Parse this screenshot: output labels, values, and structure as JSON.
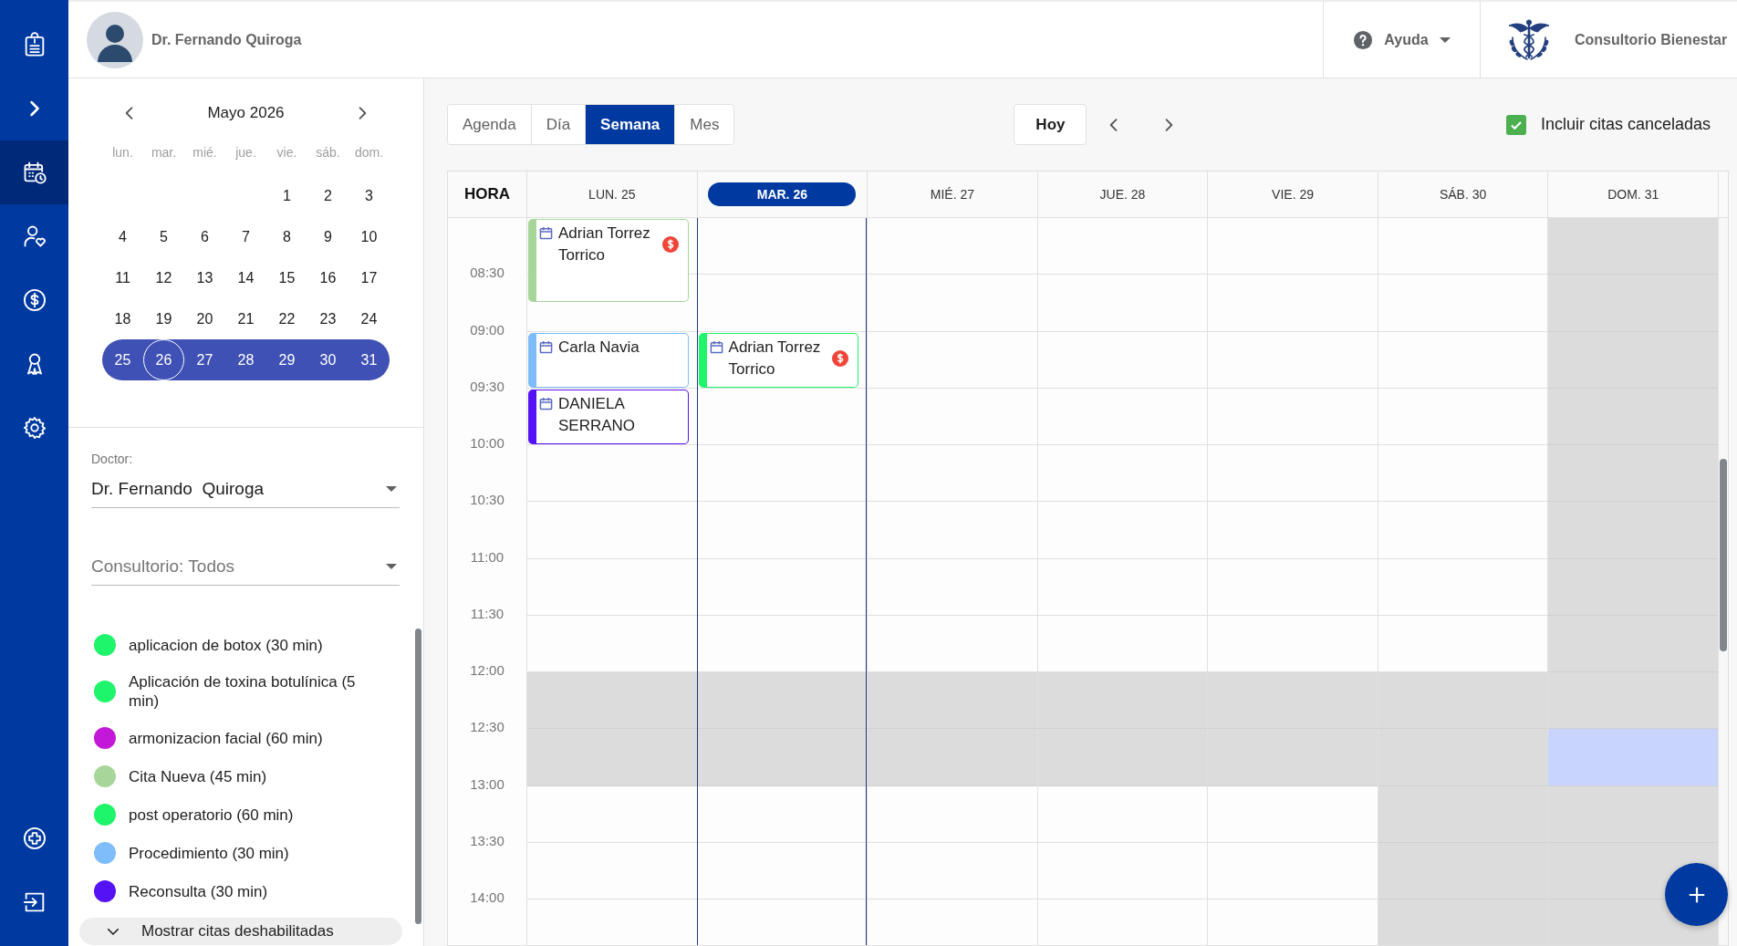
{
  "nav": {
    "top": [
      {
        "kind": "logo",
        "selected": false
      },
      {
        "kind": "expand",
        "selected": false
      },
      {
        "kind": "calendar",
        "selected": true
      },
      {
        "kind": "patients",
        "selected": false
      },
      {
        "kind": "payments",
        "selected": false
      },
      {
        "kind": "specialists",
        "selected": false
      },
      {
        "kind": "settings",
        "selected": false
      }
    ],
    "bottom": [
      {
        "kind": "add",
        "selected": false
      },
      {
        "kind": "logout",
        "selected": false
      }
    ]
  },
  "header": {
    "user": {
      "name": "Dr. Fernando Quiroga"
    },
    "help": {
      "label": "Ayuda"
    },
    "clinic": {
      "name": "Consultorio Bienestar"
    }
  },
  "mini_calendar": {
    "month": "Mayo 2026",
    "weekdays": [
      "lun.",
      "mar.",
      "mié.",
      "jue.",
      "vie.",
      "sáb.",
      "dom."
    ],
    "weeks": [
      {
        "selected": false,
        "days": [
          {
            "label": "1",
            "selected": false
          },
          {
            "label": "2",
            "selected": false
          },
          {
            "label": "3",
            "selected": false
          }
        ]
      },
      {
        "selected": false,
        "days": [
          {
            "label": "4",
            "selected": false
          },
          {
            "label": "5",
            "selected": false
          },
          {
            "label": "6",
            "selected": false
          },
          {
            "label": "7",
            "selected": false
          },
          {
            "label": "8",
            "selected": false
          },
          {
            "label": "9",
            "selected": false
          },
          {
            "label": "10",
            "selected": false
          }
        ]
      },
      {
        "selected": false,
        "days": [
          {
            "label": "11",
            "selected": false
          },
          {
            "label": "12",
            "selected": false
          },
          {
            "label": "13",
            "selected": false
          },
          {
            "label": "14",
            "selected": false
          },
          {
            "label": "15",
            "selected": false
          },
          {
            "label": "16",
            "selected": false
          },
          {
            "label": "17",
            "selected": false
          }
        ]
      },
      {
        "selected": false,
        "days": [
          {
            "label": "18",
            "selected": false
          },
          {
            "label": "19",
            "selected": false
          },
          {
            "label": "20",
            "selected": false
          },
          {
            "label": "21",
            "selected": false
          },
          {
            "label": "22",
            "selected": false
          },
          {
            "label": "23",
            "selected": false
          },
          {
            "label": "24",
            "selected": false
          }
        ]
      },
      {
        "selected": true,
        "days": [
          {
            "label": "25",
            "selected": false
          },
          {
            "label": "26",
            "selected": true
          },
          {
            "label": "27",
            "selected": false
          },
          {
            "label": "28",
            "selected": false
          },
          {
            "label": "29",
            "selected": false
          },
          {
            "label": "30",
            "selected": false
          },
          {
            "label": "31",
            "selected": false
          }
        ]
      }
    ]
  },
  "filters": {
    "doctor": {
      "label": "Doctor:",
      "value": "Dr. Fernando  Quiroga"
    },
    "office": {
      "placeholder": "Consultorio: Todos"
    }
  },
  "appointment_types": [
    {
      "label": "aplicacion de botox (30 min)",
      "color": "#1ef56a"
    },
    {
      "label": "Aplicación de toxina botulínica (5 min)",
      "color": "#1ef56a"
    },
    {
      "label": "armonizacion facial (60 min)",
      "color": "#c418d8"
    },
    {
      "label": "Cita Nueva (45 min)",
      "color": "#a8d69a"
    },
    {
      "label": "post operatorio (60 min)",
      "color": "#1ef56a"
    },
    {
      "label": "Procedimiento (30 min)",
      "color": "#7fbcfa"
    },
    {
      "label": "Reconsulta (30 min)",
      "color": "#5512f5"
    }
  ],
  "disabled_toggle": {
    "label": "Mostrar citas deshabilitadas",
    "expanded": false
  },
  "toolbar": {
    "views": [
      {
        "label": "Agenda",
        "selected": false
      },
      {
        "label": "Día",
        "selected": false
      },
      {
        "label": "Semana",
        "selected": true
      },
      {
        "label": "Mes",
        "selected": false
      }
    ],
    "today_button": {
      "label": "Hoy"
    },
    "include_cancelled": {
      "label": "Incluir citas canceladas",
      "checked": true
    }
  },
  "week": {
    "time_header": "HORA",
    "times": [
      "08:30",
      "09:00",
      "09:30",
      "10:00",
      "10:30",
      "11:00",
      "11:30",
      "12:00",
      "12:30",
      "13:00",
      "13:30",
      "14:00"
    ],
    "days": [
      {
        "label": "LUN. 25",
        "selected": false,
        "slots": [
          {
            "blocked": false,
            "selected": false,
            "events": [
              {
                "name": "Adrian Torrez Torrico",
                "kind": "long",
                "color": "#a8d69a",
                "payment_pending": true
              }
            ]
          },
          {
            "blocked": false,
            "selected": false
          },
          {
            "blocked": false,
            "selected": false,
            "events": [
              {
                "name": "Carla Navia",
                "kind": "short",
                "color": "#7fbcfa",
                "payment_pending": false
              }
            ]
          },
          {
            "blocked": false,
            "selected": false,
            "events": [
              {
                "name": "DANIELA SERRANO",
                "kind": "short",
                "color": "#5512f5",
                "payment_pending": false
              }
            ]
          },
          {
            "blocked": false,
            "selected": false
          },
          {
            "blocked": false,
            "selected": false
          },
          {
            "blocked": false,
            "selected": false
          },
          {
            "blocked": false,
            "selected": false
          },
          {
            "blocked": true,
            "selected": false
          },
          {
            "blocked": true,
            "selected": false
          },
          {
            "blocked": false,
            "selected": false
          },
          {
            "blocked": false,
            "selected": false
          },
          {
            "blocked": false,
            "selected": false
          }
        ]
      },
      {
        "label": "MAR. 26",
        "selected": true,
        "slots": [
          {
            "blocked": false,
            "selected": false
          },
          {
            "blocked": false,
            "selected": false
          },
          {
            "blocked": false,
            "selected": false,
            "events": [
              {
                "name": "Adrian Torrez Torrico",
                "kind": "short",
                "color": "#1ef56a",
                "payment_pending": true
              }
            ]
          },
          {
            "blocked": false,
            "selected": false
          },
          {
            "blocked": false,
            "selected": false
          },
          {
            "blocked": false,
            "selected": false
          },
          {
            "blocked": false,
            "selected": false
          },
          {
            "blocked": false,
            "selected": false
          },
          {
            "blocked": true,
            "selected": false
          },
          {
            "blocked": true,
            "selected": false
          },
          {
            "blocked": false,
            "selected": false
          },
          {
            "blocked": false,
            "selected": false
          },
          {
            "blocked": false,
            "selected": false
          }
        ]
      },
      {
        "label": "MIÉ. 27",
        "selected": false,
        "slots": [
          {
            "blocked": false,
            "selected": false
          },
          {
            "blocked": false,
            "selected": false
          },
          {
            "blocked": false,
            "selected": false
          },
          {
            "blocked": false,
            "selected": false
          },
          {
            "blocked": false,
            "selected": false
          },
          {
            "blocked": false,
            "selected": false
          },
          {
            "blocked": false,
            "selected": false
          },
          {
            "blocked": false,
            "selected": false
          },
          {
            "blocked": true,
            "selected": false
          },
          {
            "blocked": true,
            "selected": false
          },
          {
            "blocked": false,
            "selected": false
          },
          {
            "blocked": false,
            "selected": false
          },
          {
            "blocked": false,
            "selected": false
          }
        ]
      },
      {
        "label": "JUE. 28",
        "selected": false,
        "slots": [
          {
            "blocked": false,
            "selected": false
          },
          {
            "blocked": false,
            "selected": false
          },
          {
            "blocked": false,
            "selected": false
          },
          {
            "blocked": false,
            "selected": false
          },
          {
            "blocked": false,
            "selected": false
          },
          {
            "blocked": false,
            "selected": false
          },
          {
            "blocked": false,
            "selected": false
          },
          {
            "blocked": false,
            "selected": false
          },
          {
            "blocked": true,
            "selected": false
          },
          {
            "blocked": true,
            "selected": false
          },
          {
            "blocked": false,
            "selected": false
          },
          {
            "blocked": false,
            "selected": false
          },
          {
            "blocked": false,
            "selected": false
          }
        ]
      },
      {
        "label": "VIE. 29",
        "selected": false,
        "slots": [
          {
            "blocked": false,
            "selected": false
          },
          {
            "blocked": false,
            "selected": false
          },
          {
            "blocked": false,
            "selected": false
          },
          {
            "blocked": false,
            "selected": false
          },
          {
            "blocked": false,
            "selected": false
          },
          {
            "blocked": false,
            "selected": false
          },
          {
            "blocked": false,
            "selected": false
          },
          {
            "blocked": false,
            "selected": false
          },
          {
            "blocked": true,
            "selected": false
          },
          {
            "blocked": true,
            "selected": false
          },
          {
            "blocked": false,
            "selected": false
          },
          {
            "blocked": false,
            "selected": false
          },
          {
            "blocked": false,
            "selected": false
          }
        ]
      },
      {
        "label": "SÁB. 30",
        "selected": false,
        "slots": [
          {
            "blocked": false,
            "selected": false
          },
          {
            "blocked": false,
            "selected": false
          },
          {
            "blocked": false,
            "selected": false
          },
          {
            "blocked": false,
            "selected": false
          },
          {
            "blocked": false,
            "selected": false
          },
          {
            "blocked": false,
            "selected": false
          },
          {
            "blocked": false,
            "selected": false
          },
          {
            "blocked": false,
            "selected": false
          },
          {
            "blocked": true,
            "selected": false
          },
          {
            "blocked": true,
            "selected": false
          },
          {
            "blocked": true,
            "selected": false
          },
          {
            "blocked": true,
            "selected": false
          },
          {
            "blocked": true,
            "selected": false
          }
        ]
      },
      {
        "label": "DOM. 31",
        "selected": false,
        "slots": [
          {
            "blocked": true,
            "selected": false
          },
          {
            "blocked": true,
            "selected": false
          },
          {
            "blocked": true,
            "selected": false
          },
          {
            "blocked": true,
            "selected": false
          },
          {
            "blocked": true,
            "selected": false
          },
          {
            "blocked": true,
            "selected": false
          },
          {
            "blocked": true,
            "selected": false
          },
          {
            "blocked": true,
            "selected": false
          },
          {
            "blocked": true,
            "selected": false
          },
          {
            "blocked": true,
            "selected": true
          },
          {
            "blocked": true,
            "selected": false
          },
          {
            "blocked": true,
            "selected": false
          },
          {
            "blocked": true,
            "selected": false
          }
        ]
      }
    ]
  }
}
